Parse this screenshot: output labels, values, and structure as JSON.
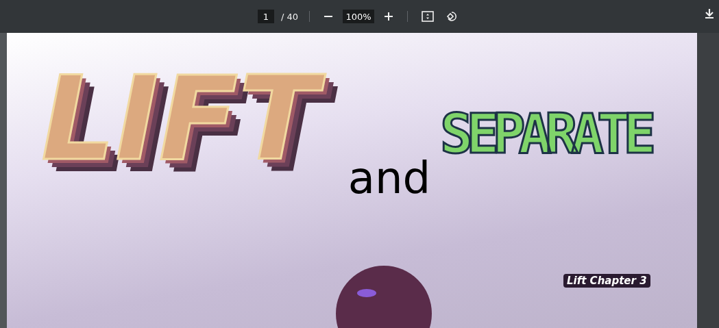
{
  "toolbar": {
    "page_input": "1",
    "page_total": "/ 40",
    "zoom_value": "100%"
  },
  "cover": {
    "title": [
      {
        "kind": "block",
        "text": "LIFT"
      },
      {
        "kind": "plain",
        "text": "and"
      },
      {
        "kind": "outline",
        "text": "SEPARATE"
      }
    ],
    "subtitle": "Lift Chapter 3"
  }
}
